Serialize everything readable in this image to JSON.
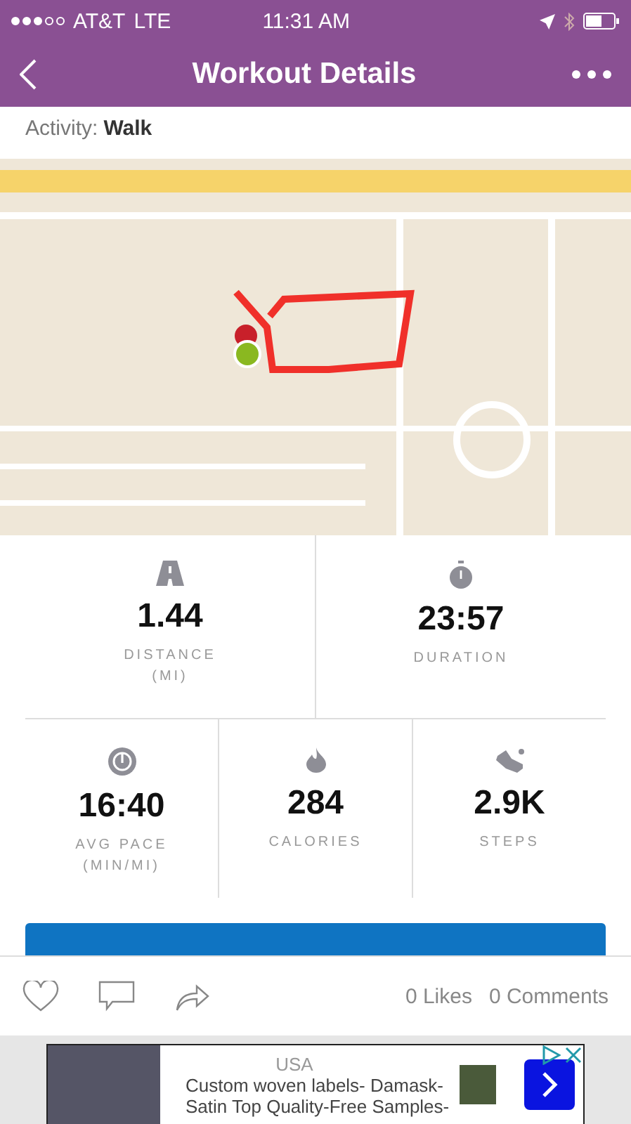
{
  "status_bar": {
    "carrier": "AT&T",
    "network": "LTE",
    "time": "11:31 AM"
  },
  "nav": {
    "title": "Workout Details"
  },
  "activity": {
    "label": "Activity:",
    "value": "Walk"
  },
  "stats_top": [
    {
      "kind": "road",
      "value": "1.44",
      "label": "DISTANCE",
      "unit": "(MI)"
    },
    {
      "kind": "stopwatch",
      "value": "23:57",
      "label": "DURATION"
    }
  ],
  "stats_bottom": [
    {
      "kind": "gauge",
      "value": "16:40",
      "label": "AVG PACE",
      "unit": "(MIN/MI)"
    },
    {
      "kind": "flame",
      "value": "284",
      "label": "CALORIES"
    },
    {
      "kind": "shoe",
      "value": "2.9K",
      "label": "STEPS"
    }
  ],
  "social": {
    "liked": false,
    "likes": "0 Likes",
    "comments": "0 Comments"
  },
  "ad": {
    "lines": [
      "USA",
      "Custom woven labels- Damask-",
      "Satin Top Quality-Free Samples-"
    ]
  }
}
